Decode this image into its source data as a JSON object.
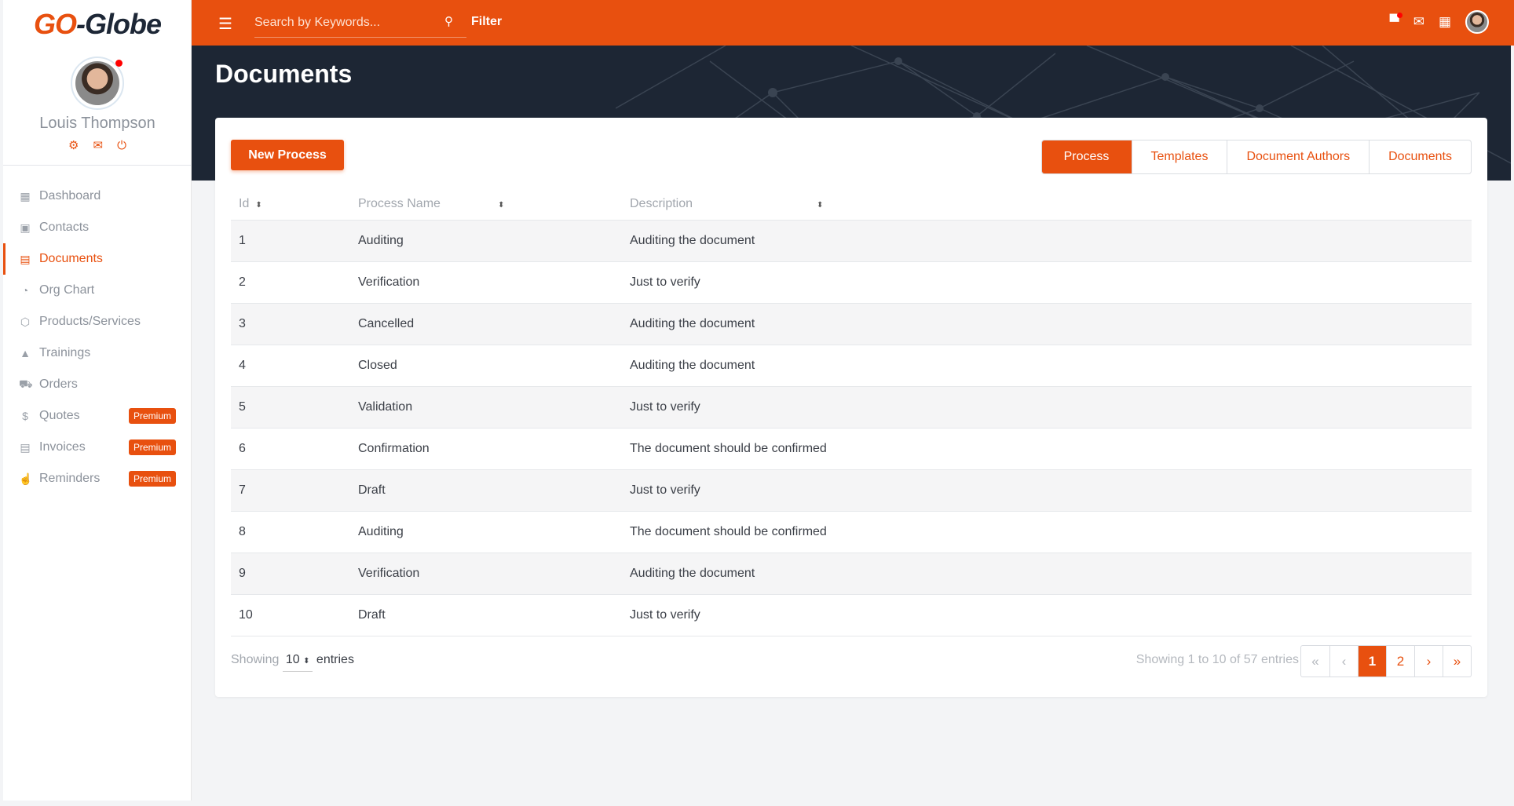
{
  "brand": {
    "logo_go": "GO",
    "logo_rest": "-Globe"
  },
  "user": {
    "name": "Louis Thompson"
  },
  "sidebar": {
    "items": [
      {
        "label": "Dashboard",
        "icon": "▦"
      },
      {
        "label": "Contacts",
        "icon": "▣"
      },
      {
        "label": "Documents",
        "icon": "▤"
      },
      {
        "label": "Org Chart",
        "icon": "◔"
      },
      {
        "label": "Products/Services",
        "icon": "⬡"
      },
      {
        "label": "Trainings",
        "icon": "▲"
      },
      {
        "label": "Orders",
        "icon": "⛟"
      },
      {
        "label": "Quotes",
        "icon": "$",
        "badge": "Premium"
      },
      {
        "label": "Invoices",
        "icon": "▤",
        "badge": "Premium"
      },
      {
        "label": "Reminders",
        "icon": "☝",
        "badge": "Premium"
      }
    ]
  },
  "topbar": {
    "search_placeholder": "Search by Keywords...",
    "filter": "Filter"
  },
  "page": {
    "title": "Documents",
    "new_button": "New Process",
    "tabs": [
      "Process",
      "Templates",
      "Document Authors",
      "Documents"
    ]
  },
  "table": {
    "headers": [
      "Id",
      "Process Name",
      "Description"
    ],
    "rows": [
      [
        "1",
        "Auditing",
        "Auditing the document"
      ],
      [
        "2",
        "Verification",
        "Just to verify"
      ],
      [
        "3",
        "Cancelled",
        "Auditing the document"
      ],
      [
        "4",
        "Closed",
        "Auditing the document"
      ],
      [
        "5",
        "Validation",
        "Just to verify"
      ],
      [
        "6",
        "Confirmation",
        "The document should be confirmed"
      ],
      [
        "7",
        "Draft",
        "Just to verify"
      ],
      [
        "8",
        "Auditing",
        "The document should be confirmed"
      ],
      [
        "9",
        "Verification",
        "Auditing the document"
      ],
      [
        "10",
        "Draft",
        "Just to verify"
      ]
    ]
  },
  "footer": {
    "showing": "Showing",
    "page_size": "10",
    "entries": "entries",
    "summary": "Showing 1 to 10 of 57 entries",
    "pages": [
      "«",
      "‹",
      "1",
      "2",
      "›",
      "»"
    ]
  },
  "colors": {
    "accent": "#e8500f",
    "dark": "#1d2634"
  }
}
